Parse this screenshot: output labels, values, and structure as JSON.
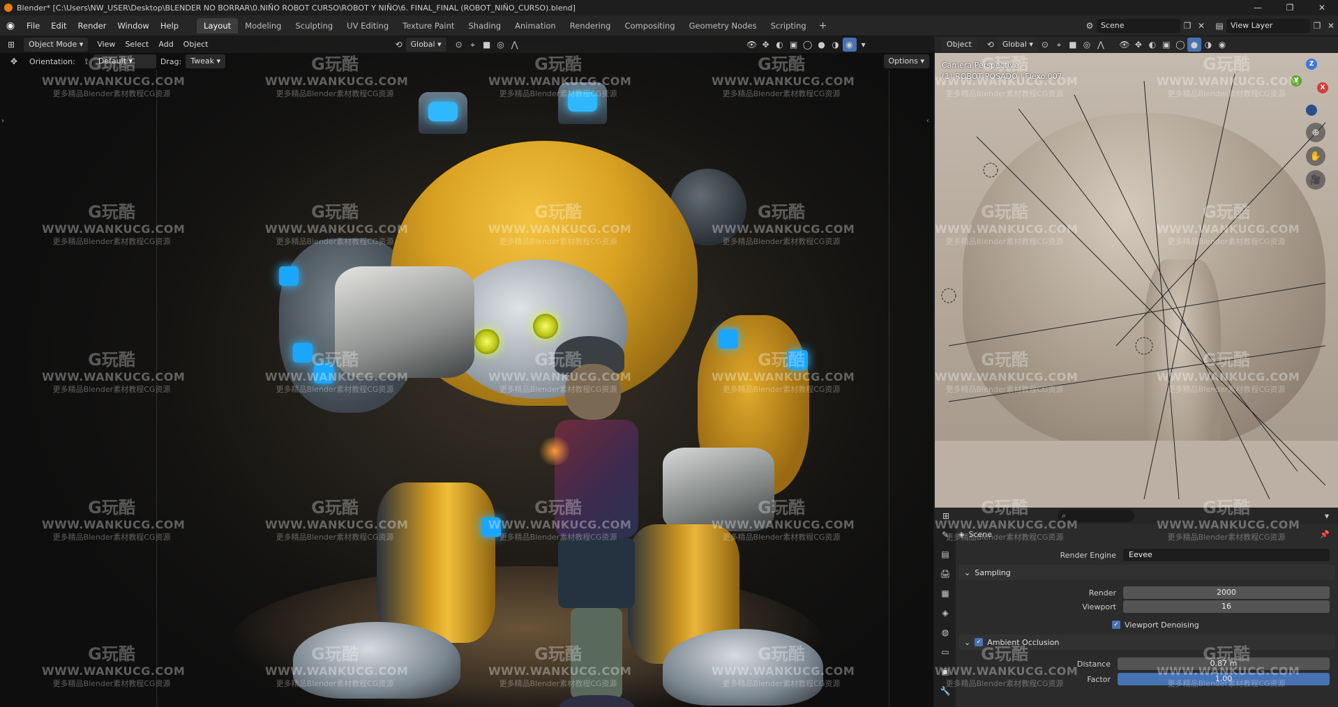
{
  "window": {
    "title": "Blender* [C:\\Users\\NW_USER\\Desktop\\BLENDER NO BORRAR\\0.NIÑO ROBOT CURSO\\ROBOT Y NIÑO\\6. FINAL_FINAL (ROBOT_NIÑO_CURSO).blend]",
    "minimize": "—",
    "maximize": "❐",
    "close": "✕"
  },
  "menu": [
    "File",
    "Edit",
    "Render",
    "Window",
    "Help"
  ],
  "workspaces": [
    "Layout",
    "Modeling",
    "Sculpting",
    "UV Editing",
    "Texture Paint",
    "Shading",
    "Animation",
    "Rendering",
    "Compositing",
    "Geometry Nodes",
    "Scripting"
  ],
  "active_workspace": "Layout",
  "top_right": {
    "scene": "Scene",
    "view_layer": "View Layer"
  },
  "viewport": {
    "mode": "Object Mode",
    "menus": [
      "View",
      "Select",
      "Add",
      "Object"
    ],
    "transform_space": "Global",
    "orientation_label": "Orientation:",
    "orientation_value": "Default",
    "drag_label": "Drag:",
    "drag_value": "Tweak",
    "options": "Options"
  },
  "camera_viewport": {
    "mode": "Object",
    "transform_space": "Global",
    "info_line1": "Camera Perspective",
    "info_line2": "(1) ROBOT POSADO | Flexo.007"
  },
  "watermark": {
    "logo": "G玩酷",
    "url": "WWW.WANKUCG.COM",
    "sub": "更多精品Blender素材教程CG资源"
  },
  "properties": {
    "context": "Scene",
    "render_engine_label": "Render Engine",
    "render_engine_value": "Eevee",
    "sampling_section": "Sampling",
    "render_label": "Render",
    "render_value": "2000",
    "viewport_label": "Viewport",
    "viewport_value": "16",
    "viewport_denoising": "Viewport Denoising",
    "ao_section": "Ambient Occlusion",
    "distance_label": "Distance",
    "distance_value": "0.87 m",
    "factor_label": "Factor",
    "factor_value": "1.00"
  },
  "colors": {
    "accent_blue": "#4772b3",
    "robot_yellow": "#e0aa2a",
    "glow_blue": "#1aa6ff"
  }
}
